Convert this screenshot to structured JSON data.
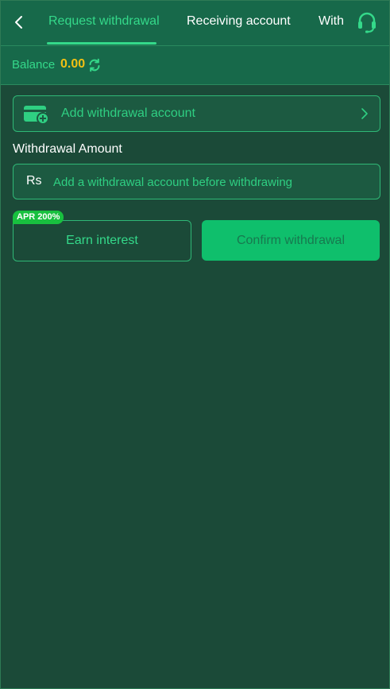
{
  "header": {
    "tabs": [
      {
        "label": "Request withdrawal",
        "active": true
      },
      {
        "label": "Receiving account",
        "active": false
      },
      {
        "label": "With",
        "active": false
      }
    ],
    "back_icon": "chevron-left-icon",
    "support_icon": "headset-icon"
  },
  "balance": {
    "label": "Balance",
    "value": "0.00",
    "refresh_icon": "refresh-icon"
  },
  "add_account": {
    "label": "Add withdrawal account",
    "icon": "wallet-add-icon",
    "chevron_icon": "chevron-right-icon"
  },
  "amount": {
    "title": "Withdrawal Amount",
    "currency": "Rs",
    "placeholder": "Add a withdrawal account before withdrawing"
  },
  "actions": {
    "badge": "APR 200%",
    "earn_label": "Earn interest",
    "confirm_label": "Confirm withdrawal"
  },
  "colors": {
    "accent": "#34d98a",
    "balance": "#f2c014",
    "background": "#1b4a38",
    "header": "#17694a",
    "confirm": "#0fbf6c",
    "badge": "#18c03f"
  }
}
